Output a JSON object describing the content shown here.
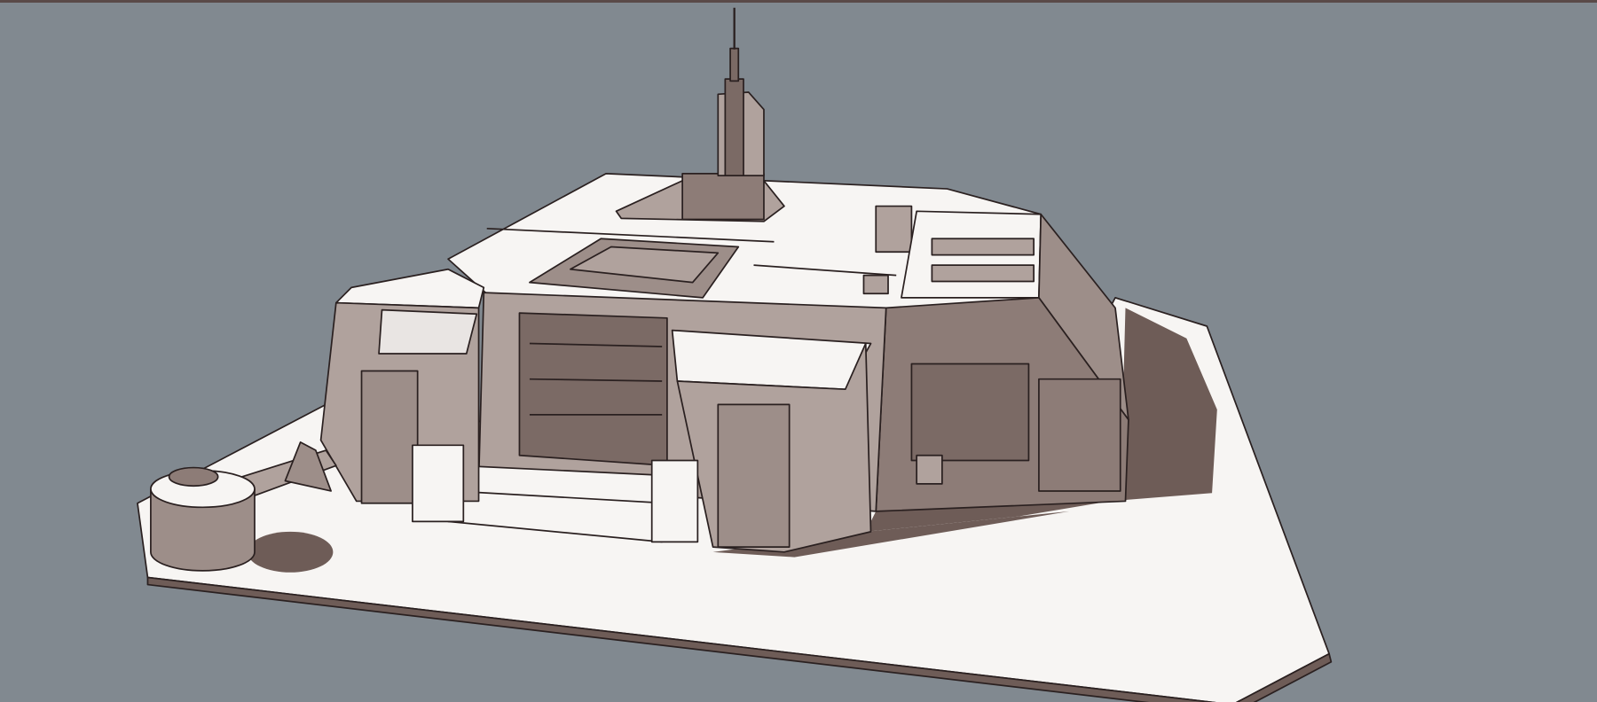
{
  "viewport": {
    "background_color": "#818990",
    "frame_color": "#5a4a48"
  },
  "model": {
    "colors": {
      "light_face": "#f7f5f3",
      "mid_face": "#b0a29d",
      "dark_face": "#7b6a65",
      "shadow": "#6e5c57",
      "outline": "#2a2020"
    }
  }
}
